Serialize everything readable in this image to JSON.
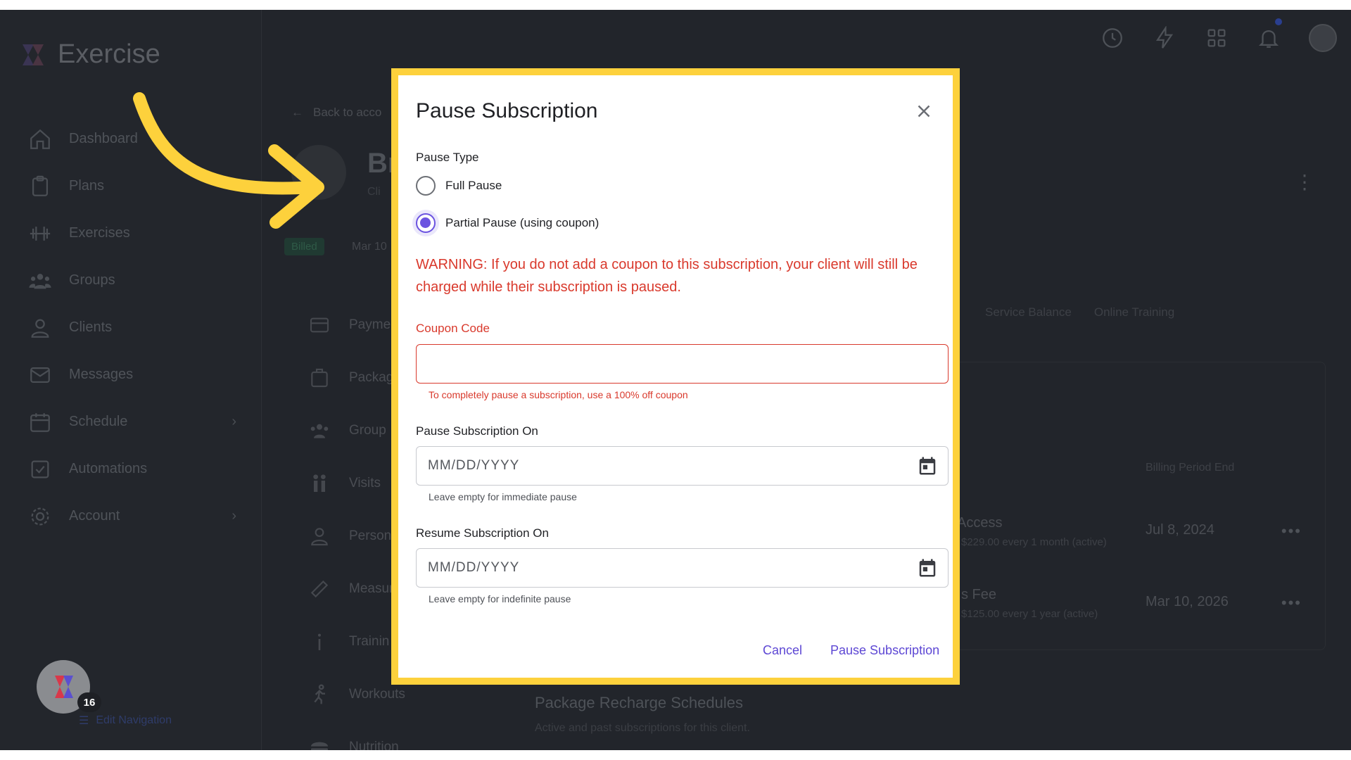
{
  "app": {
    "brand": "Exercise"
  },
  "sidebar": {
    "items": [
      {
        "label": "Dashboard",
        "icon": "home-icon"
      },
      {
        "label": "Plans",
        "icon": "clipboard-icon"
      },
      {
        "label": "Exercises",
        "icon": "dumbbell-icon"
      },
      {
        "label": "Groups",
        "icon": "groups-icon"
      },
      {
        "label": "Clients",
        "icon": "user-icon"
      },
      {
        "label": "Messages",
        "icon": "mail-icon"
      },
      {
        "label": "Schedule",
        "icon": "calendar-icon"
      },
      {
        "label": "Automations",
        "icon": "checkbox-icon"
      },
      {
        "label": "Account",
        "icon": "gear-icon"
      }
    ],
    "helper_badge": "16",
    "edit_navigation": "Edit Navigation"
  },
  "background": {
    "back_link": "Back to acco",
    "client_name_partial": "Br",
    "client_sub_partial": "Cli",
    "billed": "Billed",
    "date": "Mar 10",
    "submenu": [
      "Payme",
      "Packag",
      "Group",
      "Visits",
      "Person",
      "Measur",
      "Trainin",
      "Workouts",
      "Nutrition"
    ],
    "tabs": [
      "Service Balance",
      "Online Training"
    ],
    "table_header": "Billing Period End",
    "rows": [
      {
        "title": "Access",
        "sub": "$229.00 every 1 month (active)",
        "date": "Jul 8, 2024"
      },
      {
        "title": "s Fee",
        "sub": "$125.00 every 1 year (active)",
        "date": "Mar 10, 2026"
      }
    ],
    "package_title": "Package Recharge Schedules",
    "package_sub": "Active and past subscriptions for this client."
  },
  "modal": {
    "title": "Pause Subscription",
    "pause_type_label": "Pause Type",
    "options": [
      {
        "label": "Full Pause",
        "selected": false
      },
      {
        "label": "Partial Pause (using coupon)",
        "selected": true
      }
    ],
    "warning": "WARNING: If you do not add a coupon to this subscription, your client will still be charged while their subscription is paused.",
    "coupon_label": "Coupon Code",
    "coupon_value": "",
    "coupon_hint": "To completely pause a subscription, use a 100% off coupon",
    "pause_on_label": "Pause Subscription On",
    "pause_on_placeholder": "MM/DD/YYYY",
    "pause_on_hint": "Leave empty for immediate pause",
    "resume_on_label": "Resume Subscription On",
    "resume_on_placeholder": "MM/DD/YYYY",
    "resume_on_hint": "Leave empty for indefinite pause",
    "cancel": "Cancel",
    "submit": "Pause Subscription"
  },
  "colors": {
    "accent": "#6b53e0",
    "error": "#d9392c",
    "highlight": "#fdd13c",
    "overlay": "#22252b"
  }
}
